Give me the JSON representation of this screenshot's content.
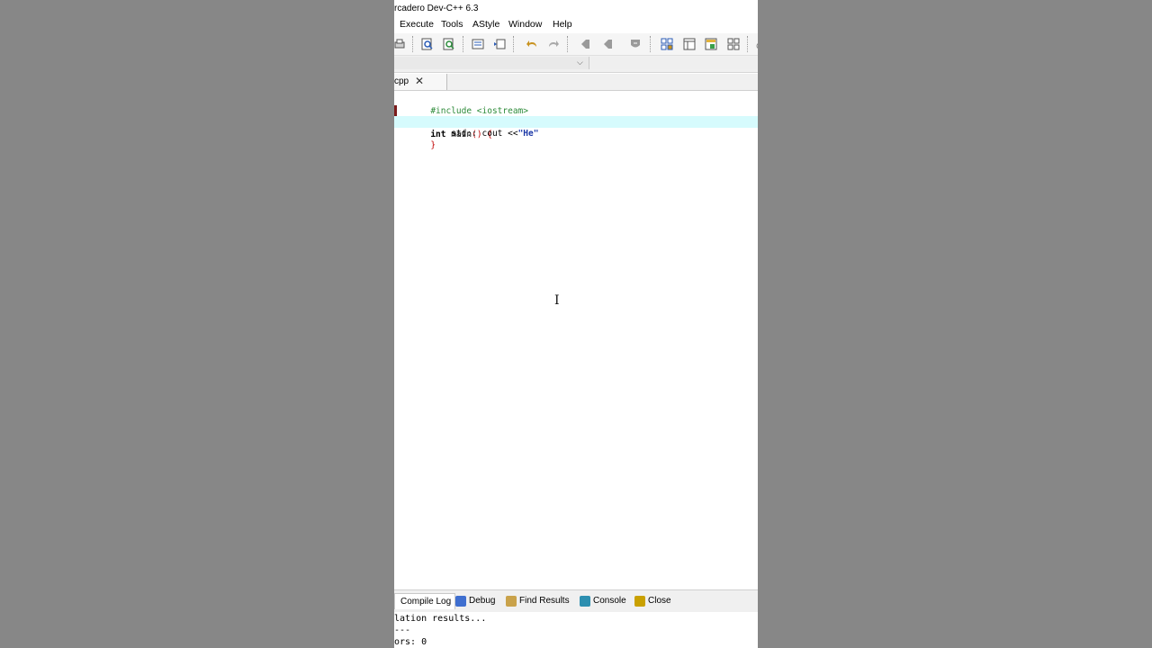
{
  "window": {
    "title": "rcadero Dev-C++ 6.3"
  },
  "menu": [
    "Execute",
    "Tools",
    "AStyle",
    "Window",
    "Help"
  ],
  "toolbar": {
    "icons": [
      "print-icon",
      "find-icon",
      "replace-icon",
      "toggle-comment-icon",
      "indent-icon",
      "undo-icon",
      "redo-icon",
      "prev-bookmark-icon",
      "next-bookmark-icon",
      "bookmark-icon",
      "new-class-icon",
      "project-view-icon",
      "class-browser-icon",
      "layout-icon",
      "more-icon"
    ]
  },
  "editor_tab": {
    "label": "cpp",
    "close": "✕"
  },
  "code": {
    "line1": "#include <iostream>",
    "line2_kw": "int",
    "line2_rest": " main",
    "line2_paren": "() {",
    "line3_prefix": "    std:: cout <<",
    "line3_str": "\"He\"",
    "line4": "}"
  },
  "cursor": "I",
  "bottom_tabs": [
    "Compile Log",
    "Debug",
    "Find Results",
    "Console",
    "Close"
  ],
  "output": {
    "line1": "lation results...",
    "line2": "---",
    "line3": "ors: 0"
  },
  "colors": {
    "active_line": "#d6fbfd",
    "preprocessor": "#2e8b3a",
    "string": "#1e3aa8",
    "bracket": "#c00000"
  }
}
